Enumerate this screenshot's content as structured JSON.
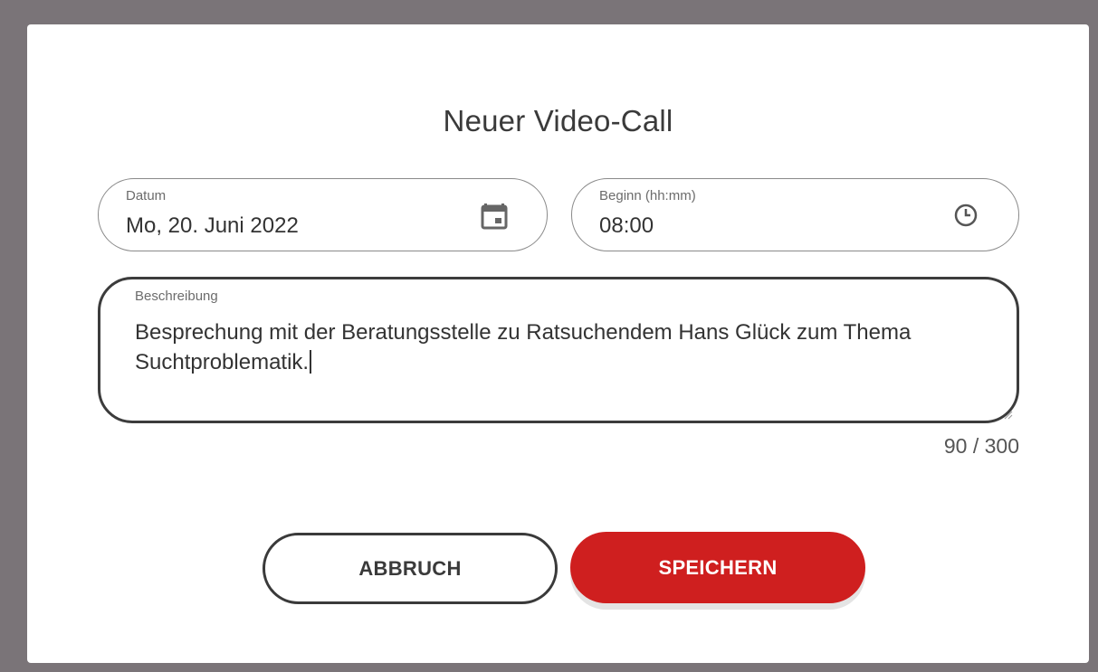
{
  "dialog": {
    "title": "Neuer Video-Call",
    "date_field": {
      "label": "Datum",
      "value": "Mo, 20. Juni 2022",
      "icon": "calendar-icon"
    },
    "time_field": {
      "label": "Beginn (hh:mm)",
      "value": "08:00",
      "icon": "clock-icon"
    },
    "description_field": {
      "label": "Beschreibung",
      "value_line1": "Besprechung mit der Beratungsstelle zu Ratsuchendem Hans Glück zum Thema",
      "value_line2": "Suchtproblematik."
    },
    "char_counter": "90 / 300",
    "cancel_label": "ABBRUCH",
    "save_label": "SPEICHERN"
  },
  "colors": {
    "backdrop": "#7a7478",
    "accent": "#cf1f1f",
    "text": "#333333"
  }
}
